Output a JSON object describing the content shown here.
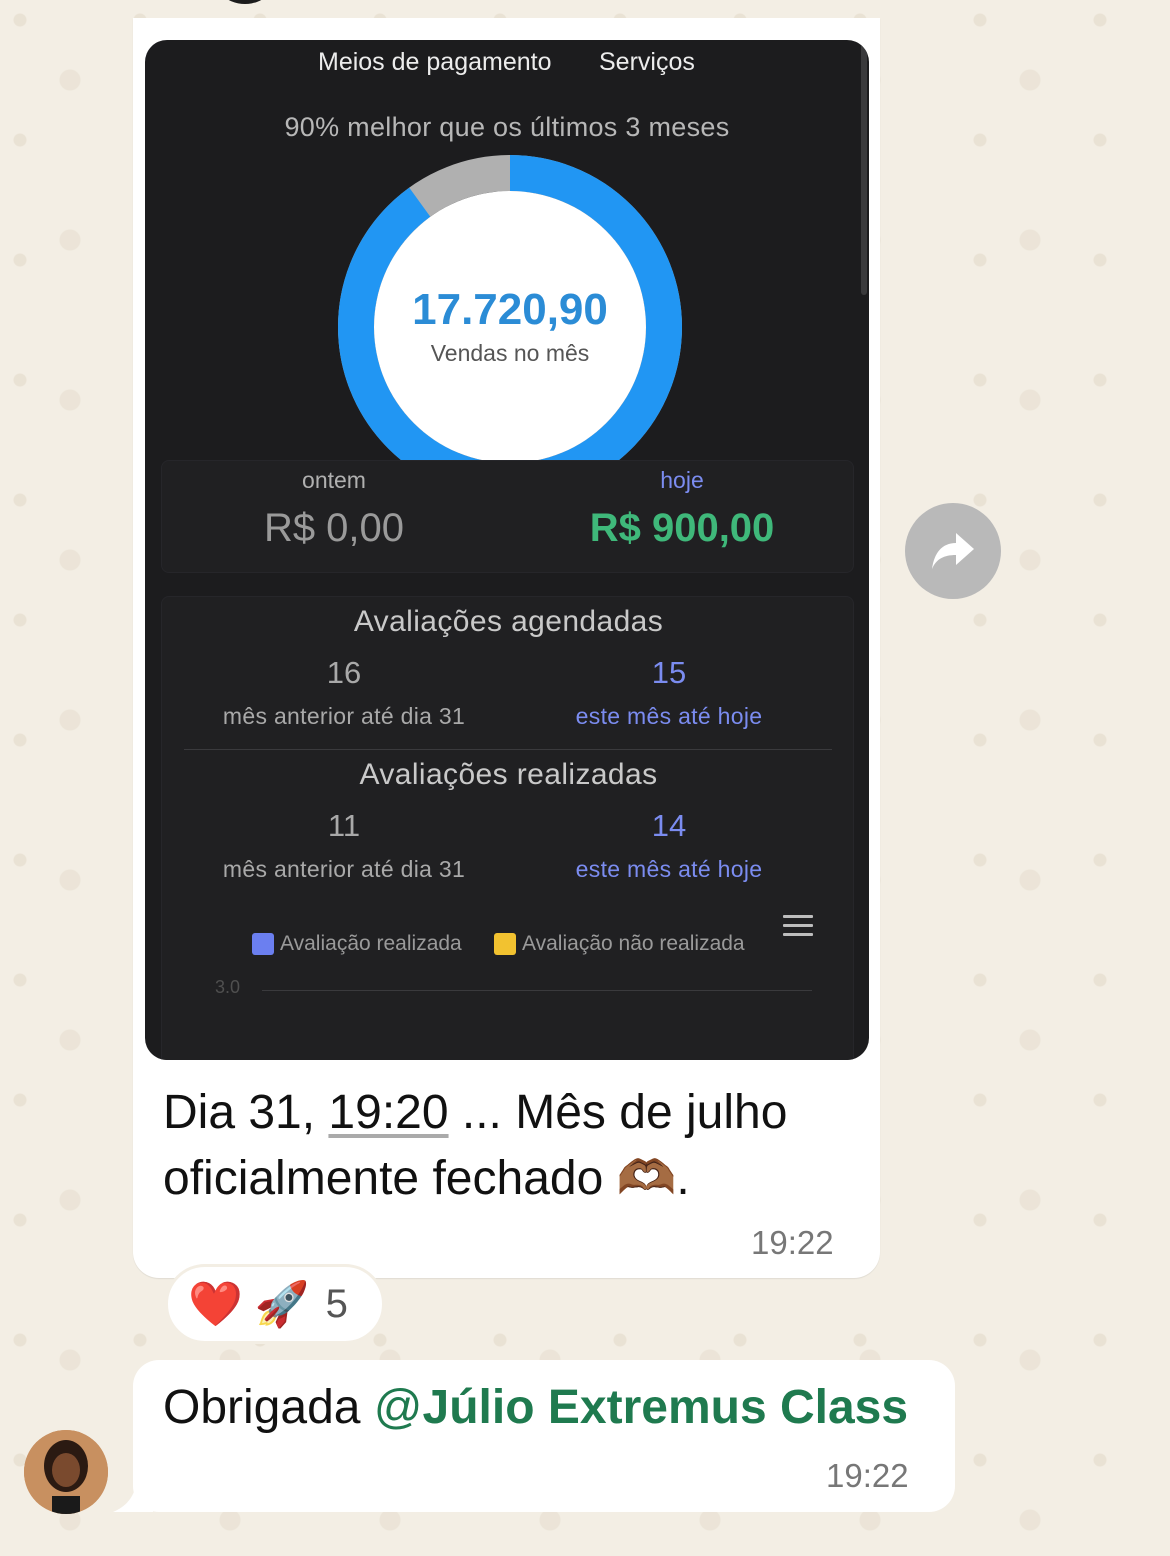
{
  "chat": {
    "message_1": {
      "screenshot": {
        "nav_tabs": [
          "Meios de pagamento",
          "Serviços"
        ],
        "compare_text": "90% melhor que os últimos 3 meses",
        "donut": {
          "value": "17.720,90",
          "label": "Vendas no mês",
          "progress_fraction": 0.9,
          "progress_color": "#2196f3",
          "remainder_color": "#b0b0b0"
        },
        "sales": {
          "yesterday_label": "ontem",
          "yesterday_value": "R$ 0,00",
          "today_label": "hoje",
          "today_value": "R$ 900,00"
        },
        "scheduled": {
          "title": "Avaliações agendadas",
          "prev_value": "16",
          "prev_desc": "mês anterior até dia 31",
          "curr_value": "15",
          "curr_desc": "este mês até hoje"
        },
        "performed": {
          "title": "Avaliações realizadas",
          "prev_value": "11",
          "prev_desc": "mês anterior até dia 31",
          "curr_value": "14",
          "curr_desc": "este mês até hoje"
        },
        "legend": [
          {
            "label": "Avaliação realizada",
            "color": "#6b7ff0"
          },
          {
            "label": "Avaliação não realizada",
            "color": "#f2c230"
          }
        ],
        "axis_tick": "3.0"
      },
      "caption_pre": "Dia 31, ",
      "caption_time_link": "19:20",
      "caption_post": " ... Mês de julho oficialmente fechado 🫶🏾.",
      "time": "19:22"
    },
    "reactions": {
      "emojis": [
        "❤️",
        "🚀"
      ],
      "count": "5"
    },
    "message_2": {
      "text": "Obrigada ",
      "mention_at": "@",
      "mention_name": "Júlio Extremus Class",
      "time": "19:22"
    },
    "icons": {
      "forward": "forward-arrow-icon",
      "menu": "hamburger-menu-icon"
    }
  }
}
